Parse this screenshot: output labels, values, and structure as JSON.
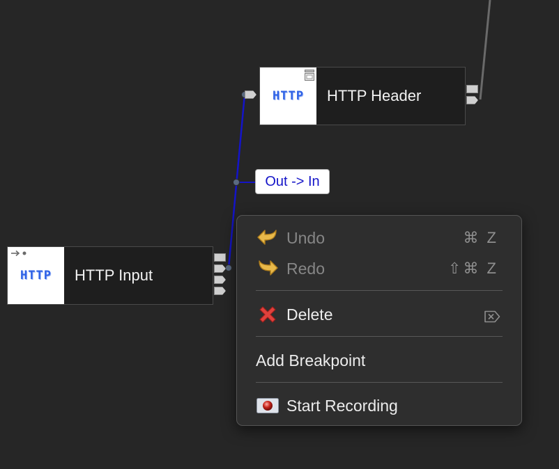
{
  "nodes": {
    "http_header": {
      "logo": "HTTP",
      "title": "HTTP Header"
    },
    "http_input": {
      "logo": "HTTP",
      "title": "HTTP Input"
    }
  },
  "connection": {
    "label": "Out -> In",
    "color": "#1414c8"
  },
  "context_menu": {
    "undo": {
      "label": "Undo",
      "shortcut": "⌘ Z",
      "enabled": false,
      "icon": "undo-arrow-icon"
    },
    "redo": {
      "label": "Redo",
      "shortcut": "⇧⌘ Z",
      "enabled": false,
      "icon": "redo-arrow-icon"
    },
    "delete": {
      "label": "Delete",
      "icon": "red-x-icon",
      "shortcut_icon": "delete-key-icon"
    },
    "add_breakpoint": {
      "label": "Add Breakpoint"
    },
    "start_recording": {
      "label": "Start Recording",
      "icon": "record-icon"
    }
  },
  "colors": {
    "canvas": "#262626",
    "node_body": "#1e1e1e",
    "http_logo": "#2f62e6",
    "menu_bg": "#2e2e2e",
    "wire": "#1414c8"
  }
}
